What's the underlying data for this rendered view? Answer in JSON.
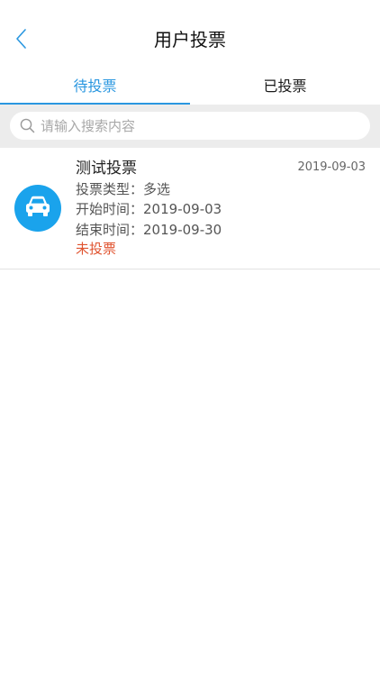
{
  "header": {
    "title": "用户投票",
    "back_icon": "chevron-left-icon",
    "accent_color": "#2a97e0"
  },
  "tabs": [
    {
      "label": "待投票",
      "active": true
    },
    {
      "label": "已投票",
      "active": false
    }
  ],
  "search": {
    "placeholder": "请输入搜索内容",
    "value": "",
    "icon": "search-icon"
  },
  "items": [
    {
      "title": "测试投票",
      "date": "2019-09-03",
      "icon": "car-icon",
      "icon_color": "#1aa3ec",
      "type_label": "投票类型：",
      "type_value": "多选",
      "start_label": "开始时间：",
      "start_value": "2019-09-03",
      "end_label": "结束时间：",
      "end_value": "2019-09-30",
      "status": "未投票",
      "status_color": "#e0532f"
    }
  ]
}
